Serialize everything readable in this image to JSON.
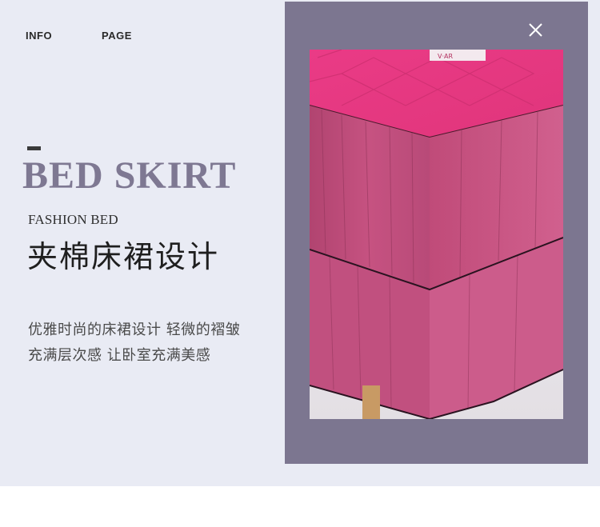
{
  "nav": {
    "info": "INFO",
    "page": "PAGE"
  },
  "hero": {
    "title": "BED SKIRT",
    "subtitle_en": "FASHION BED",
    "subtitle_zh": "夹棉床裙设计"
  },
  "description": {
    "line1": "优雅时尚的床裙设计   轻微的褶皱",
    "line2": "充满层次感   让卧室充满美感"
  },
  "icons": {
    "close": "close-icon",
    "dash": "dash-marker"
  },
  "colors": {
    "background": "#e9ebf4",
    "frame": "#7c7690",
    "title": "#7e7892",
    "fabric": "#c04a78"
  }
}
